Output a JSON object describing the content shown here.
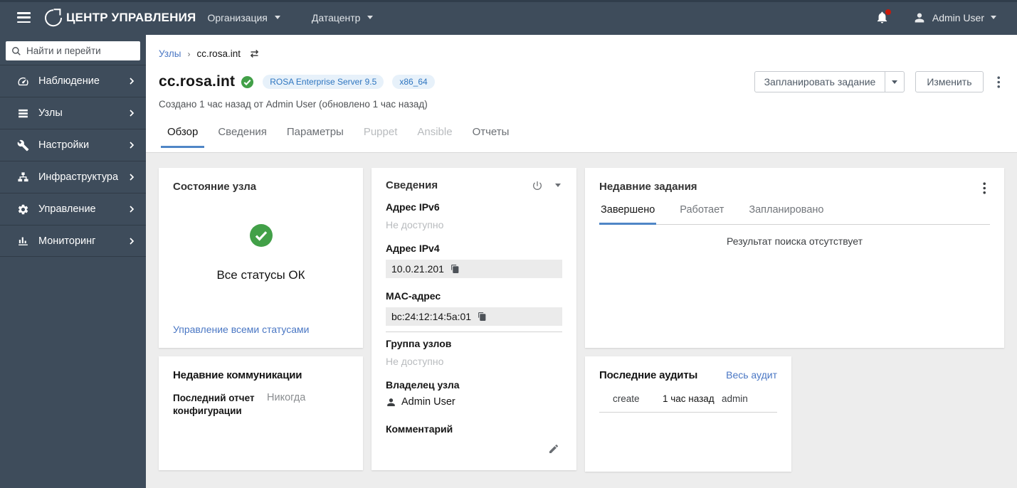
{
  "topbar": {
    "brand": "ЦЕНТР УПРАВЛЕНИЯ",
    "nav": [
      {
        "label": "Организация"
      },
      {
        "label": "Датацентр"
      }
    ],
    "user": "Admin User"
  },
  "sidebar": {
    "search_placeholder": "Найти и перейти",
    "items": [
      {
        "label": "Наблюдение",
        "icon": "tachometer-icon"
      },
      {
        "label": "Узлы",
        "icon": "server-icon"
      },
      {
        "label": "Настройки",
        "icon": "wrench-icon"
      },
      {
        "label": "Инфраструктура",
        "icon": "sitemap-icon"
      },
      {
        "label": "Управление",
        "icon": "gear-icon"
      },
      {
        "label": "Мониторинг",
        "icon": "chart-icon"
      }
    ]
  },
  "header": {
    "breadcrumb": [
      "Узлы",
      "cc.rosa.int"
    ],
    "title": "cc.rosa.int",
    "badges": [
      "ROSA Enterprise Server 9.5",
      "x86_64"
    ],
    "subtitle": "Создано 1 час назад от Admin User (обновлено 1 час назад)",
    "actions": {
      "schedule_job": "Запланировать задание",
      "edit": "Изменить"
    }
  },
  "tabs": [
    {
      "label": "Обзор",
      "state": "active"
    },
    {
      "label": "Сведения",
      "state": "normal"
    },
    {
      "label": "Параметры",
      "state": "normal"
    },
    {
      "label": "Puppet",
      "state": "disabled"
    },
    {
      "label": "Ansible",
      "state": "disabled"
    },
    {
      "label": "Отчеты",
      "state": "normal"
    }
  ],
  "cards": {
    "host_status": {
      "title": "Состояние узла",
      "status": "Все статусы ОК",
      "link": "Управление всеми статусами"
    },
    "recent_communication": {
      "title": "Недавние коммуникации",
      "label": "Последний отчет конфигурации",
      "value": "Никогда"
    },
    "details": {
      "title": "Сведения",
      "fields": [
        {
          "label": "Адрес IPv6",
          "value": "Не доступно"
        },
        {
          "label": "Адрес IPv4",
          "value": "10.0.21.201"
        },
        {
          "label": "MAC-адрес",
          "value": "bc:24:12:14:5a:01"
        },
        {
          "label": "Группа узлов",
          "value": "Не доступно"
        },
        {
          "label": "Владелец узла",
          "value": "Admin User"
        },
        {
          "label": "Комментарий",
          "value": ""
        }
      ]
    },
    "recent_jobs": {
      "title": "Недавние задания",
      "tabs": [
        "Завершено",
        "Работает",
        "Запланировано"
      ],
      "active_tab": "Завершено",
      "empty": "Результат поиска отсутствует"
    },
    "recent_audits": {
      "title": "Последние аудиты",
      "link": "Весь аудит",
      "rows": [
        [
          "create",
          "1 час назад",
          "admin"
        ]
      ]
    }
  },
  "colors": {
    "topbar_bg": "#3e4c5b",
    "link": "#4a77c4",
    "tab_underline": "#4f86c6",
    "badge_bg": "#e7f1fa",
    "badge_text": "#2f76c0",
    "success_green": "#42a048",
    "notification_dot": "#c9190b"
  }
}
